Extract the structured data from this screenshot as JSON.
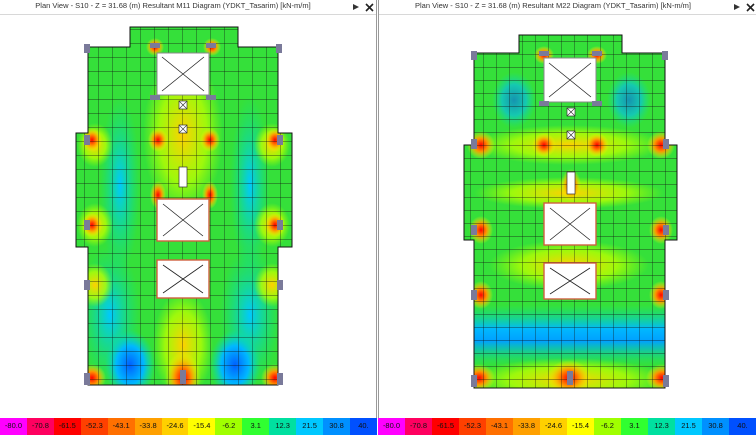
{
  "left_pane": {
    "title": "Plan View - S10 - Z = 31.68 (m)    Resultant M11 Diagram    (YDKT_Tasarim)  [kN-m/m]",
    "pin_icon": "pin-icon",
    "close_icon": "close-icon"
  },
  "right_pane": {
    "title": "Plan View - S10 - Z = 31.68 (m)    Resultant M22 Diagram    (YDKT_Tasarim)  [kN-m/m]",
    "pin_icon": "pin-icon",
    "close_icon": "close-icon"
  },
  "legend": {
    "labels": [
      "-80.0",
      "-70.8",
      "-61.5",
      "-52.3",
      "-43.1",
      "-33.8",
      "-24.6",
      "-15.4",
      "-6.2",
      "3.1",
      "12.3",
      "21.5",
      "30.8",
      "40."
    ],
    "colors": [
      "#ff00ff",
      "#ff0060",
      "#ff0000",
      "#ff4000",
      "#ff7000",
      "#ffa000",
      "#ffd000",
      "#ffff00",
      "#a0ff00",
      "#30ff30",
      "#00e0a0",
      "#00c8ff",
      "#0090ff",
      "#0050ff"
    ]
  },
  "colors": {
    "mesh_base": "#2fdc3a",
    "mesh_line": "#111111",
    "support_column": "#7a7a9a",
    "opening_border": "#d06040"
  }
}
